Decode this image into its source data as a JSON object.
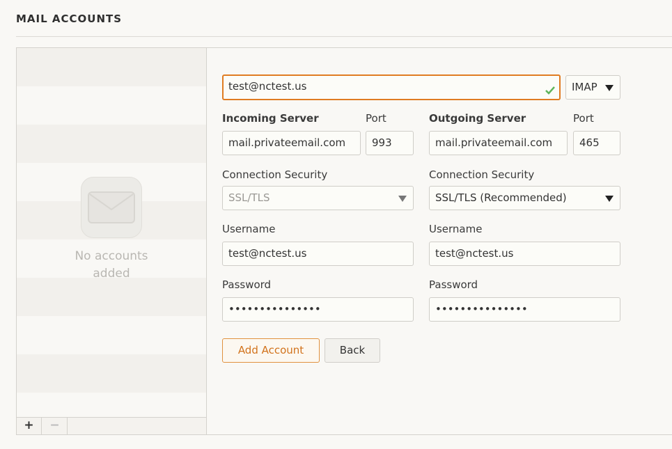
{
  "page": {
    "title": "MAIL ACCOUNTS"
  },
  "sidebar": {
    "empty_text": "No accounts added",
    "add_label": "+",
    "remove_label": "−"
  },
  "form": {
    "email": {
      "value": "test@nctest.us",
      "valid": true
    },
    "protocol": {
      "value": "IMAP",
      "options": [
        "IMAP"
      ]
    },
    "incoming": {
      "heading": "Incoming Server",
      "server": "mail.privateemail.com",
      "port_label": "Port",
      "port": "993",
      "security_label": "Connection Security",
      "security": "SSL/TLS",
      "username_label": "Username",
      "username": "test@nctest.us",
      "password_label": "Password",
      "password": "•••••••••••••••"
    },
    "outgoing": {
      "heading": "Outgoing Server",
      "server": "mail.privateemail.com",
      "port_label": "Port",
      "port": "465",
      "security_label": "Connection Security",
      "security": "SSL/TLS (Recommended)",
      "username_label": "Username",
      "username": "test@nctest.us",
      "password_label": "Password",
      "password": "•••••••••••••••"
    },
    "add_account_label": "Add Account",
    "back_label": "Back"
  },
  "colors": {
    "accent": "#e07c22",
    "valid": "#5fb55b",
    "background": "#f9f8f5"
  }
}
